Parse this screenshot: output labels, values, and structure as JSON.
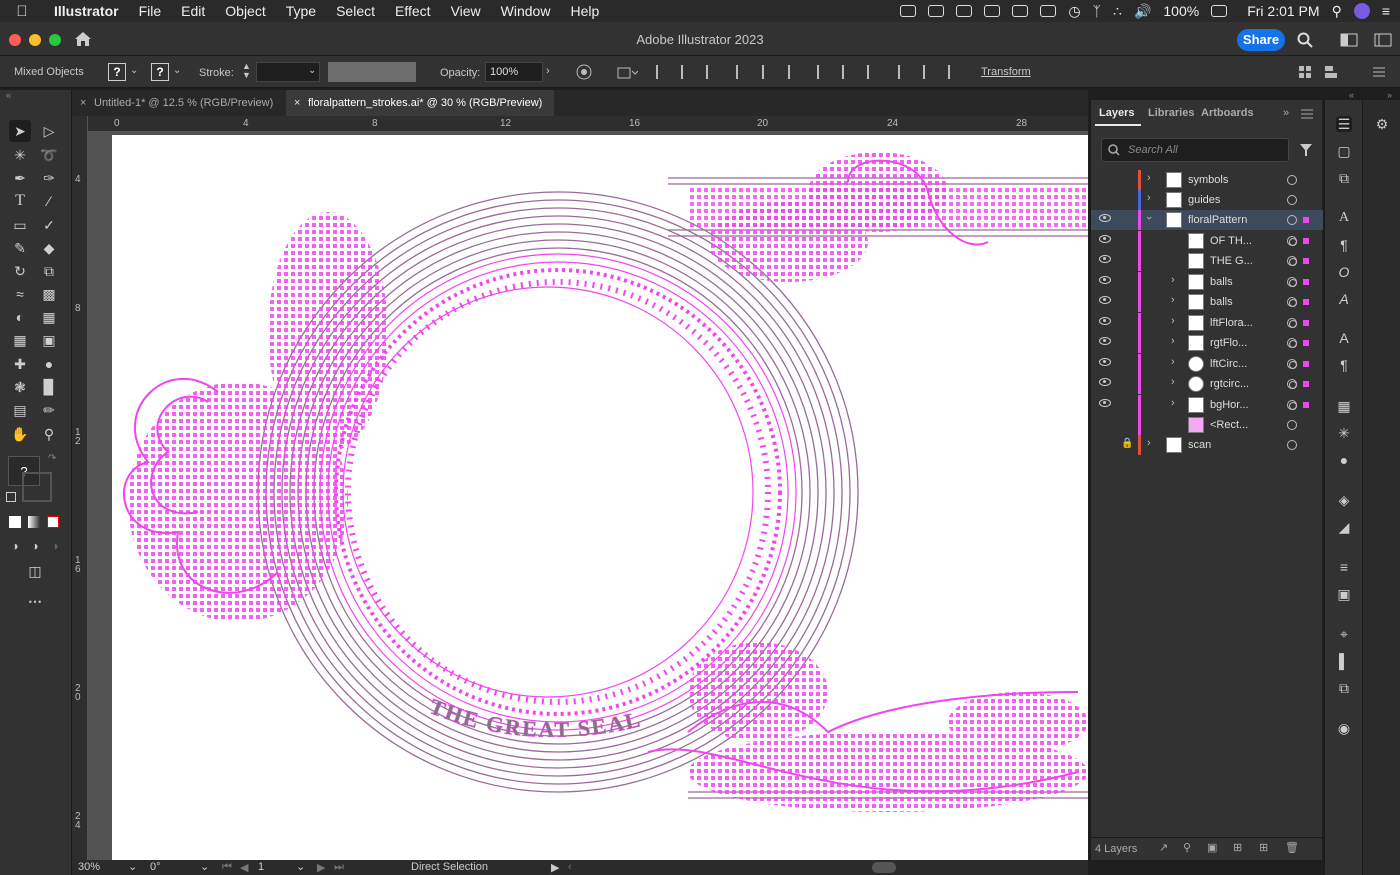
{
  "menubar": {
    "app_name": "Illustrator",
    "items": [
      "File",
      "Edit",
      "Object",
      "Type",
      "Select",
      "Effect",
      "View",
      "Window",
      "Help"
    ],
    "battery": "100%",
    "clock": "Fri 2:01 PM"
  },
  "window": {
    "title": "Adobe Illustrator 2023",
    "share_label": "Share"
  },
  "control_bar": {
    "selection_label": "Mixed Objects",
    "fill_label": "?",
    "stroke_swatch_label": "?",
    "stroke_label": "Stroke:",
    "opacity_label": "Opacity:",
    "opacity_value": "100%",
    "transform_label": "Transform"
  },
  "doc_tabs": [
    {
      "label": "Untitled-1* @ 12.5 % (RGB/Preview)",
      "active": false
    },
    {
      "label": "floralpattern_strokes.ai* @ 30 % (RGB/Preview)",
      "active": true
    }
  ],
  "rulers": {
    "horizontal": [
      "0",
      "4",
      "8",
      "12",
      "16",
      "20",
      "24",
      "28"
    ],
    "vertical": [
      "4",
      "8",
      "12",
      "16",
      "20",
      "24"
    ]
  },
  "artwork": {
    "text": "THE GREAT SEAL",
    "selection_color": "#f046f0",
    "stroke_color": "#9a6a9a"
  },
  "status_bar": {
    "zoom": "30%",
    "rotation": "0°",
    "artboard": "1",
    "tool": "Direct Selection"
  },
  "layers_panel": {
    "tabs": [
      "Layers",
      "Libraries",
      "Artboards"
    ],
    "search_placeholder": "Search All",
    "rows": [
      {
        "name": "symbols",
        "color": "#e0503a"
      },
      {
        "name": "guides",
        "color": "#4a66e0"
      },
      {
        "name": "floralPattern",
        "color": "#f046f0"
      },
      {
        "name": "OF TH...",
        "color": "#f046f0"
      },
      {
        "name": "THE G...",
        "color": "#f046f0"
      },
      {
        "name": "balls",
        "color": "#f046f0"
      },
      {
        "name": "balls",
        "color": "#f046f0"
      },
      {
        "name": "lftFlora...",
        "color": "#f046f0"
      },
      {
        "name": "rgtFlo...",
        "color": "#f046f0"
      },
      {
        "name": "lftCirc...",
        "color": "#f046f0"
      },
      {
        "name": "rgtcirc...",
        "color": "#f046f0"
      },
      {
        "name": "bgHor...",
        "color": "#f046f0"
      },
      {
        "name": "<Rect...",
        "color": "#f046f0"
      },
      {
        "name": "scan",
        "color": "#e0503a"
      }
    ],
    "footer_count": "4 Layers"
  }
}
